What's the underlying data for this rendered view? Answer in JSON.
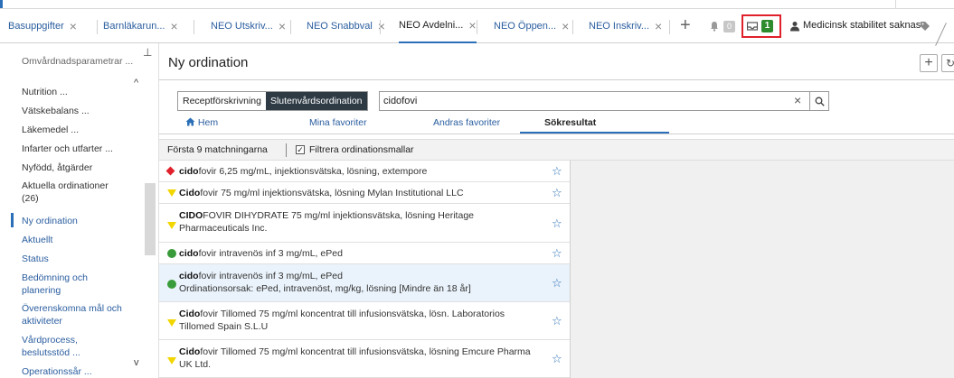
{
  "tabs": [
    {
      "label": "Basuppgifter",
      "active": false
    },
    {
      "label": "Barnläkarun...",
      "active": false
    },
    {
      "label": "NEO Utskriv...",
      "active": false
    },
    {
      "label": "NEO Snabbval",
      "active": false
    },
    {
      "label": "NEO Avdelni...",
      "active": true
    },
    {
      "label": "NEO Öppen...",
      "active": false
    },
    {
      "label": "NEO Inskriv...",
      "active": false
    }
  ],
  "toolbar": {
    "notification_count": "0",
    "inbox_count": "1",
    "patient_status": "Medicinsk stabilitet saknas"
  },
  "sidebar": {
    "items": [
      {
        "label": "Omvårdnadsparametrar ..."
      },
      {
        "label": "Nutrition ..."
      },
      {
        "label": "Vätskebalans ..."
      },
      {
        "label": "Läkemedel ..."
      },
      {
        "label": "Infarter och utfarter ..."
      },
      {
        "label": "Nyfödd, åtgärder"
      },
      {
        "label": "Aktuella ordinationer"
      },
      {
        "label": "(26)"
      },
      {
        "label": "Ny ordination"
      },
      {
        "label": "Aktuellt"
      },
      {
        "label": "Status"
      },
      {
        "label": "Bedömning och"
      },
      {
        "label": "planering"
      },
      {
        "label": "Överenskomna mål och"
      },
      {
        "label": "aktiviteter"
      },
      {
        "label": "Vårdprocess,"
      },
      {
        "label": "beslutsstöd ..."
      },
      {
        "label": "Operationssår ..."
      }
    ]
  },
  "main": {
    "title": "Ny ordination",
    "order_type": {
      "options": [
        "Receptförskrivning",
        "Slutenvårdsordination"
      ],
      "selected": "Slutenvårdsordination"
    },
    "search": {
      "value": "cidofovi",
      "placeholder": ""
    },
    "nav_tabs": [
      {
        "label": "Hem"
      },
      {
        "label": "Mina favoriter"
      },
      {
        "label": "Andras favoriter"
      },
      {
        "label": "Sökresultat"
      }
    ],
    "match_count_text": "Första 9 matchningarna",
    "filter_label": "Filtrera ordinationsmallar",
    "filter_checked": true,
    "results": [
      {
        "bold": "cido",
        "rest": "fovir 6,25 mg/mL, injektionsvätska, lösning, extempore",
        "line2": "",
        "indicator": "red-diamond"
      },
      {
        "bold": "Cido",
        "rest": "fovir 75 mg/ml injektionsvätska, lösning Mylan Institutional LLC",
        "line2": "",
        "indicator": "yellow-triangle"
      },
      {
        "bold": "CIDO",
        "rest": "FOVIR DIHYDRATE 75 mg/ml injektionsvätska, lösning Heritage",
        "line2": "Pharmaceuticals Inc.",
        "indicator": "yellow-triangle"
      },
      {
        "bold": "cido",
        "rest": "fovir intravenös inf 3 mg/mL, ePed",
        "line2": "",
        "indicator": "green-circle"
      },
      {
        "bold": "cido",
        "rest": "fovir intravenös inf 3 mg/mL, ePed",
        "line2": "Ordinationsorsak: ePed, intravenöst, mg/kg, lösning [Mindre än 18 år]",
        "indicator": "green-circle",
        "selected": true
      },
      {
        "bold": "Cido",
        "rest": "fovir Tillomed 75 mg/ml koncentrat till infusionsvätska, lösn. Laboratorios",
        "line2": "Tillomed Spain S.L.U",
        "indicator": "yellow-triangle"
      },
      {
        "bold": "Cido",
        "rest": "fovir Tillomed 75 mg/ml koncentrat till infusionsvätska, lösning Emcure Pharma",
        "line2": "UK Ltd.",
        "indicator": "yellow-triangle"
      }
    ]
  },
  "colors": {
    "accent": "#2a6fb8",
    "highlight_border": "#e0202a",
    "badge_green": "#2e8b2e"
  }
}
